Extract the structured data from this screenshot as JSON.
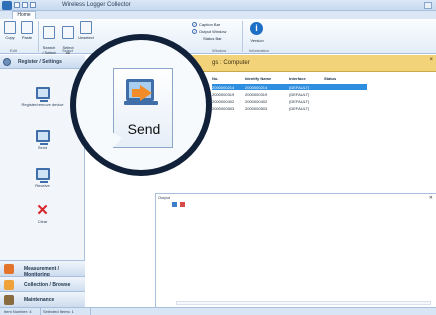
{
  "window": {
    "title": "Wireless Logger Collector"
  },
  "ribbon": {
    "tab_home": "Home",
    "buttons": {
      "copy": "Copy",
      "paste": "Paste",
      "search": "Search\n/ Select",
      "select_all": "Select\nAll",
      "unselect": "Unselect"
    },
    "groups": {
      "edit": "Edit",
      "select": "Select",
      "window": "Window",
      "information": "Information"
    },
    "checks": {
      "caption_bar": "Caption Bar",
      "output_window": "Output Window",
      "status_bar": "Status Bar"
    },
    "version": "Version"
  },
  "left_panel": {
    "title": "Register / Settings",
    "items": {
      "register": "Register/remove device",
      "send": "Send",
      "receive": "Receive",
      "clear": "Clear"
    },
    "nav": {
      "measurement": "Measurement / Monitoring",
      "collection": "Collection / Browse",
      "maintenance": "Maintenance"
    }
  },
  "list": {
    "title": "gs : Computer",
    "columns": [
      "No.",
      "Identify Name",
      "Interface",
      "Status"
    ],
    "rows": [
      [
        "2000000214",
        "2000000214",
        "(DEFAULT)",
        ""
      ],
      [
        "2000000319",
        "2000000319",
        "(DEFAULT)",
        ""
      ],
      [
        "2000000402",
        "2000000402",
        "(DEFAULT)",
        ""
      ],
      [
        "2000000503",
        "2000000503",
        "(DEFAULT)",
        ""
      ]
    ],
    "selected_row": 0
  },
  "output": {
    "title": "Output",
    "pin": "✕"
  },
  "status_bar": {
    "item_number": "Item Number: 4",
    "selected_items": "Selected Items: 1"
  },
  "zoom": {
    "label": "Send"
  },
  "colors": {
    "list_header": "#f3d37a",
    "selection": "#2e8fe0",
    "callout_border": "#12213a",
    "clear": "#d6252b",
    "send_arrow": "#f28c28"
  }
}
